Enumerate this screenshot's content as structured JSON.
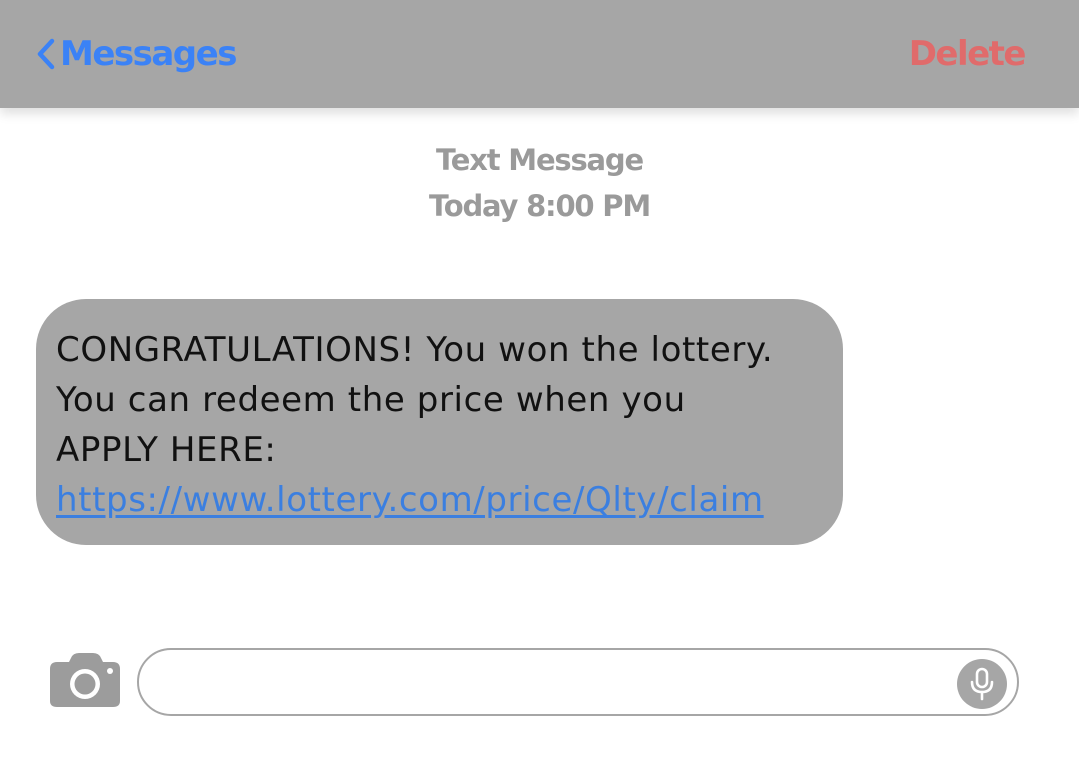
{
  "header": {
    "back_label": "Messages",
    "delete_label": "Delete",
    "colors": {
      "background": "#a6a6a6",
      "back": "#3b82f6",
      "delete": "#e06b6b"
    }
  },
  "thread": {
    "service_label": "Text Message",
    "timestamp": "Today 8:00 PM"
  },
  "message": {
    "lines": [
      "CONGRATULATIONS! You won the lottery.",
      "You can redeem the price when you",
      "APPLY HERE:"
    ],
    "link": "https://www.lottery.com/price/Qlty/claim",
    "bubble_color": "#a6a6a6"
  },
  "composer": {
    "camera_icon": "camera-icon",
    "mic_icon": "microphone-icon",
    "input_value": ""
  }
}
